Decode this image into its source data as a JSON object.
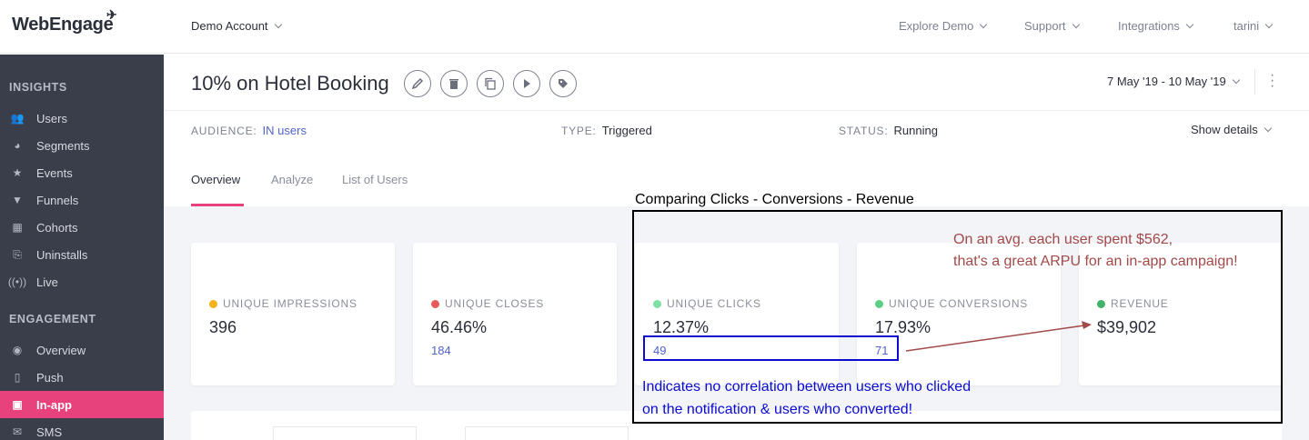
{
  "topbar": {
    "logo": "WebEngage",
    "account": "Demo Account",
    "nav": [
      "Explore Demo",
      "Support",
      "Integrations",
      "tarini"
    ]
  },
  "sidebar": {
    "sections": [
      {
        "title": "INSIGHTS",
        "items": [
          {
            "label": "Users",
            "icon": "users-icon"
          },
          {
            "label": "Segments",
            "icon": "pie-icon"
          },
          {
            "label": "Events",
            "icon": "star-icon"
          },
          {
            "label": "Funnels",
            "icon": "funnel-icon"
          },
          {
            "label": "Cohorts",
            "icon": "grid-icon"
          },
          {
            "label": "Uninstalls",
            "icon": "uninstall-icon"
          },
          {
            "label": "Live",
            "icon": "broadcast-icon"
          }
        ]
      },
      {
        "title": "ENGAGEMENT",
        "items": [
          {
            "label": "Overview",
            "icon": "eye-icon"
          },
          {
            "label": "Push",
            "icon": "mobile-icon"
          },
          {
            "label": "In-app",
            "icon": "inapp-icon",
            "active": true
          },
          {
            "label": "SMS",
            "icon": "sms-icon"
          }
        ]
      }
    ],
    "active_color": "#e8427c"
  },
  "campaign": {
    "title": "10% on Hotel Booking",
    "actions": [
      "edit-icon",
      "delete-icon",
      "copy-icon",
      "play-icon",
      "tag-icon"
    ],
    "date_range": "7 May '19 - 10 May '19",
    "audience_label": "AUDIENCE:",
    "audience_value": "IN users",
    "type_label": "TYPE:",
    "type_value": "Triggered",
    "status_label": "STATUS:",
    "status_value": "Running",
    "show_details": "Show details"
  },
  "tabs": [
    {
      "label": "Overview",
      "active": true
    },
    {
      "label": "Analyze"
    },
    {
      "label": "List of Users"
    }
  ],
  "cards": [
    {
      "label": "UNIQUE IMPRESSIONS",
      "value": "396",
      "sub": "",
      "dot": "#f2b21b"
    },
    {
      "label": "UNIQUE CLOSES",
      "value": "46.46%",
      "sub": "184",
      "dot": "#e85a5a"
    },
    {
      "label": "UNIQUE CLICKS",
      "value": "12.37%",
      "sub": "49",
      "dot": "#7fe0a4"
    },
    {
      "label": "UNIQUE CONVERSIONS",
      "value": "17.93%",
      "sub": "71",
      "dot": "#5ccf84"
    },
    {
      "label": "REVENUE",
      "value": "$39,902",
      "sub": "",
      "dot": "#3fb36a"
    }
  ],
  "annotations": {
    "title": "Comparing Clicks - Conversions - Revenue",
    "red_line1": "On an avg. each user spent $562,",
    "red_line2": "that's a great ARPU for an in-app campaign!",
    "blue_line1": "Indicates no correlation between users who clicked",
    "blue_line2": "on the notification & users who converted!"
  }
}
